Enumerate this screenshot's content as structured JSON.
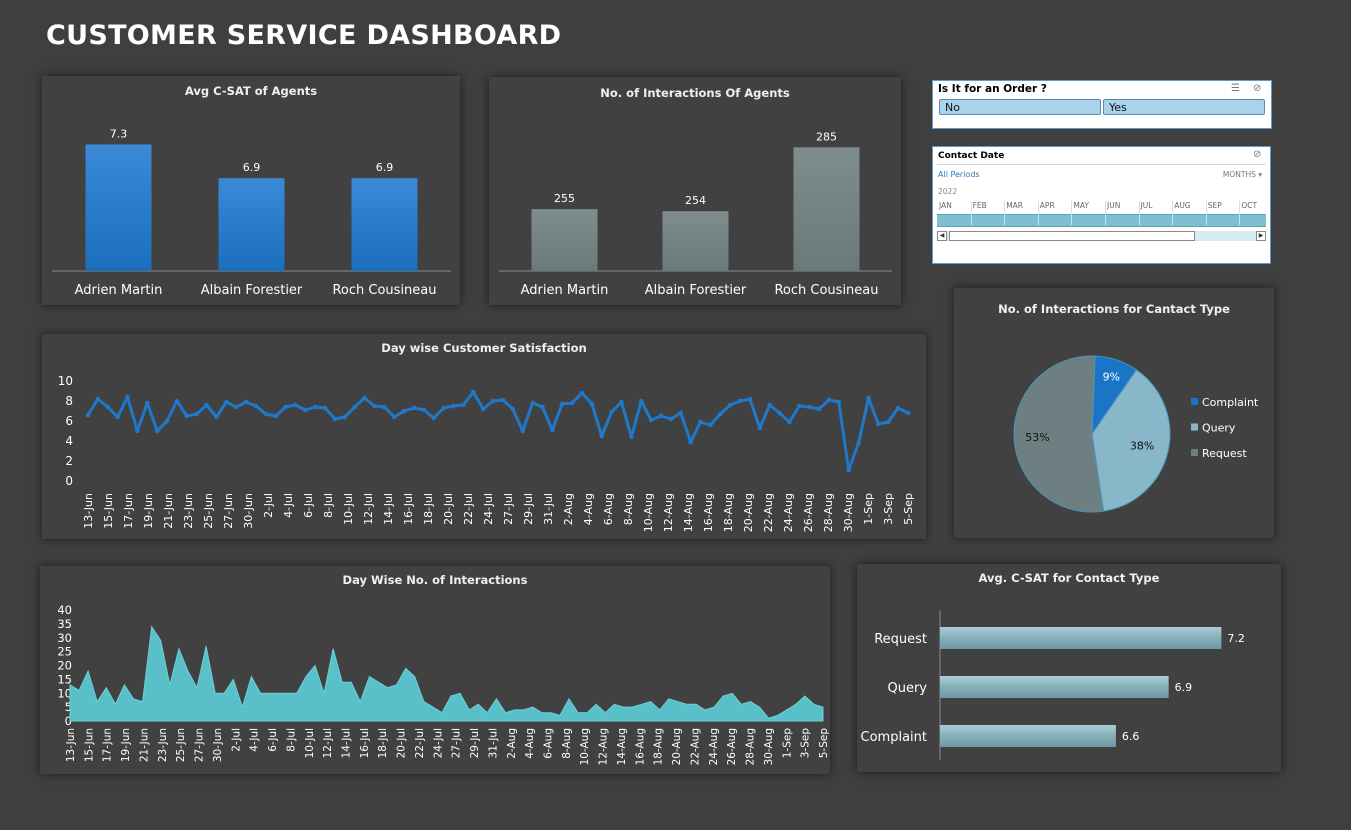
{
  "title": "CUSTOMER SERVICE DASHBOARD",
  "colors": {
    "background": "#3f3f3f",
    "panel": "#414141",
    "blue": "#1b75c7",
    "gray": "#6f7f7f",
    "teal": "#5fc0c8",
    "hbar": "#7ea8b3"
  },
  "panels": {
    "csat_agents": "Avg C-SAT of Agents",
    "interactions_agents": "No. of Interactions Of Agents",
    "csat_daily": "Day wise Customer Satisfaction",
    "interactions_daily": "Day Wise No. of Interactions",
    "contact_type_pie": "No. of Interactions for Cantact Type",
    "csat_contact_type": "Avg. C-SAT for Contact Type"
  },
  "order_slicer": {
    "header": "Is It for an Order ?",
    "options": [
      "No",
      "Yes"
    ]
  },
  "date_slicer": {
    "header": "Contact  Date",
    "periods": "All Periods",
    "level": "MONTHS",
    "year": "2022",
    "months": [
      "JAN",
      "FEB",
      "MAR",
      "APR",
      "MAY",
      "JUN",
      "JUL",
      "AUG",
      "SEP",
      "OCT"
    ]
  },
  "chart_data": [
    {
      "type": "bar",
      "categories": [
        "Adrien Martin",
        "Albain Forestier",
        "Roch Cousineau"
      ],
      "values": [
        7.3,
        6.9,
        6.9
      ],
      "value_labels": [
        "7.3",
        "6.9",
        "6.9"
      ],
      "title": "Avg C-SAT of Agents",
      "ylim": [
        5.8,
        7.4
      ]
    },
    {
      "type": "bar",
      "categories": [
        "Adrien Martin",
        "Albain Forestier",
        "Roch Cousineau"
      ],
      "values": [
        255,
        254,
        285
      ],
      "value_labels": [
        "255",
        "254",
        "285"
      ],
      "title": "No. of Interactions Of Agents",
      "ylim": [
        225,
        290
      ]
    },
    {
      "type": "line",
      "title": "Day wise Customer Satisfaction",
      "x_start": "2022-06-13",
      "tick_labels": [
        "13-Jun",
        "15-Jun",
        "17-Jun",
        "19-Jun",
        "21-Jun",
        "23-Jun",
        "25-Jun",
        "27-Jun",
        "30-Jun",
        "2-Jul",
        "4-Jul",
        "6-Jul",
        "8-Jul",
        "10-Jul",
        "12-Jul",
        "14-Jul",
        "16-Jul",
        "18-Jul",
        "20-Jul",
        "22-Jul",
        "24-Jul",
        "27-Jul",
        "29-Jul",
        "31-Jul",
        "2-Aug",
        "4-Aug",
        "6-Aug",
        "8-Aug",
        "10-Aug",
        "12-Aug",
        "14-Aug",
        "16-Aug",
        "18-Aug",
        "20-Aug",
        "22-Aug",
        "24-Aug",
        "26-Aug",
        "28-Aug",
        "30-Aug",
        "1-Sep",
        "3-Sep",
        "5-Sep"
      ],
      "yticks": [
        "0",
        "2",
        "4",
        "6",
        "8",
        "10"
      ],
      "ylim": [
        0,
        10
      ],
      "values": [
        6.6,
        8.2,
        7.4,
        6.4,
        8.4,
        5.0,
        7.8,
        5.0,
        6.0,
        8.0,
        6.5,
        6.7,
        7.6,
        6.4,
        7.9,
        7.4,
        7.9,
        7.5,
        6.7,
        6.5,
        7.4,
        7.6,
        7.1,
        7.4,
        7.3,
        6.2,
        6.4,
        7.4,
        8.3,
        7.5,
        7.4,
        6.4,
        7.0,
        7.3,
        7.1,
        6.3,
        7.3,
        7.5,
        7.6,
        8.9,
        7.2,
        8.0,
        8.1,
        7.2,
        5.0,
        7.8,
        7.4,
        5.1,
        7.7,
        7.8,
        8.8,
        7.7,
        4.5,
        6.9,
        7.9,
        4.4,
        8.0,
        6.1,
        6.5,
        6.2,
        6.8,
        3.9,
        5.9,
        5.6,
        6.7,
        7.6,
        8.0,
        8.2,
        5.3,
        7.6,
        6.8,
        5.9,
        7.5,
        7.4,
        7.2,
        8.1,
        7.9,
        1.1,
        3.8,
        8.3,
        5.7,
        5.9,
        7.3,
        6.8
      ]
    },
    {
      "type": "area",
      "title": "Day Wise No. of Interactions",
      "x_start": "2022-06-13",
      "tick_labels": [
        "13-Jun",
        "15-Jun",
        "17-Jun",
        "19-Jun",
        "21-Jun",
        "23-Jun",
        "25-Jun",
        "27-Jun",
        "30-Jun",
        "2-Jul",
        "4-Jul",
        "6-Jul",
        "8-Jul",
        "10-Jul",
        "12-Jul",
        "14-Jul",
        "16-Jul",
        "18-Jul",
        "20-Jul",
        "22-Jul",
        "24-Jul",
        "27-Jul",
        "29-Jul",
        "31-Jul",
        "2-Aug",
        "4-Aug",
        "6-Aug",
        "8-Aug",
        "10-Aug",
        "12-Aug",
        "14-Aug",
        "16-Aug",
        "18-Aug",
        "20-Aug",
        "22-Aug",
        "24-Aug",
        "26-Aug",
        "28-Aug",
        "30-Aug",
        "1-Sep",
        "3-Sep",
        "5-Sep"
      ],
      "yticks": [
        "0",
        "5",
        "10",
        "15",
        "20",
        "25",
        "30",
        "35",
        "40"
      ],
      "ylim": [
        0,
        40
      ],
      "values": [
        13,
        11,
        18,
        7,
        12,
        6,
        13,
        8,
        7,
        34,
        29,
        13,
        26,
        18,
        12,
        27,
        10,
        10,
        15,
        5,
        16,
        10,
        10,
        10,
        10,
        10,
        16,
        20,
        10,
        26,
        14,
        14,
        7,
        16,
        14,
        12,
        13,
        19,
        16,
        7,
        5,
        3,
        9,
        10,
        4,
        6,
        3,
        8,
        3,
        4,
        4,
        5,
        3,
        3,
        2,
        8,
        3,
        3,
        6,
        3,
        6,
        5,
        5,
        6,
        7,
        4,
        8,
        7,
        6,
        6,
        4,
        5,
        9,
        10,
        6,
        7,
        5,
        1,
        2,
        4,
        6,
        9,
        6,
        5
      ]
    },
    {
      "type": "pie",
      "title": "No. of Interactions for Cantact Type",
      "legend_position": "right",
      "slices": [
        {
          "label": "Complaint",
          "value": 9,
          "text": "9%",
          "color": "#1b75c7"
        },
        {
          "label": "Query",
          "value": 38,
          "text": "38%",
          "color": "#88b7c9"
        },
        {
          "label": "Request",
          "value": 53,
          "text": "53%",
          "color": "#6d7f81"
        }
      ]
    },
    {
      "type": "bar",
      "orientation": "horizontal",
      "title": "Avg. C-SAT for Contact Type",
      "categories": [
        "Request",
        "Query",
        "Complaint"
      ],
      "values": [
        7.2,
        6.9,
        6.6
      ],
      "value_labels": [
        "7.2",
        "6.9",
        "6.6"
      ],
      "xlim": [
        5.6,
        7.3
      ]
    }
  ]
}
